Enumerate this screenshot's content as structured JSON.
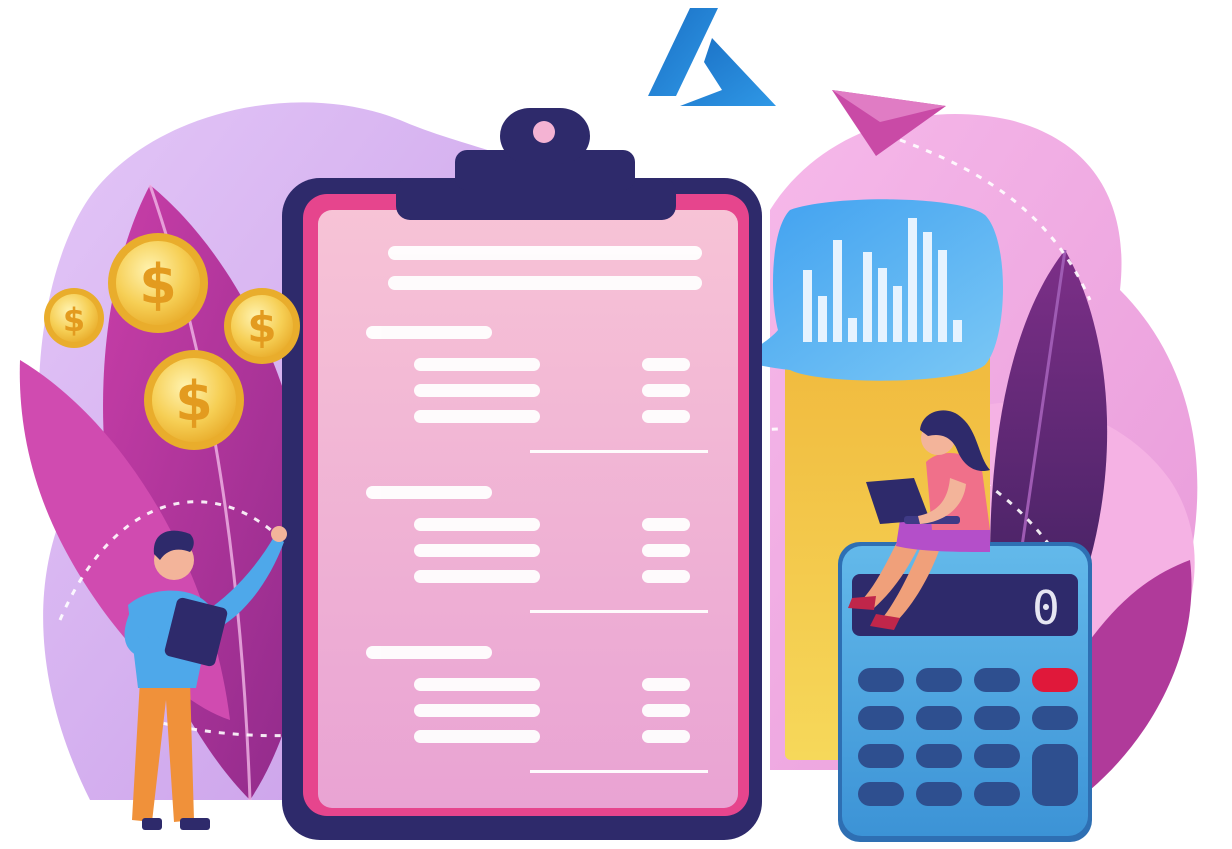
{
  "illustration": {
    "calculator_display": "0",
    "colors": {
      "brand_logo": "#1e7fd4",
      "clipboard_frame": "#2e2a6b",
      "clipboard_paper": "#f4b3d3",
      "blob_lavender": "#d7b6f2",
      "blob_pink": "#f2a6df",
      "leaf_magenta": "#b02d9c",
      "leaf_purple": "#6b2c7a",
      "coin_gold": "#f6c94a",
      "calculator_body": "#5ab2e6",
      "calculator_key_red": "#e0183a",
      "chart_bubble": "#4aa7ee",
      "paper_plane": "#c94aa6"
    },
    "icons": [
      "azure-logo-icon",
      "dollar-coin-icon",
      "paper-plane-icon",
      "bar-chart-icon",
      "calculator-icon",
      "clipboard-icon"
    ]
  }
}
